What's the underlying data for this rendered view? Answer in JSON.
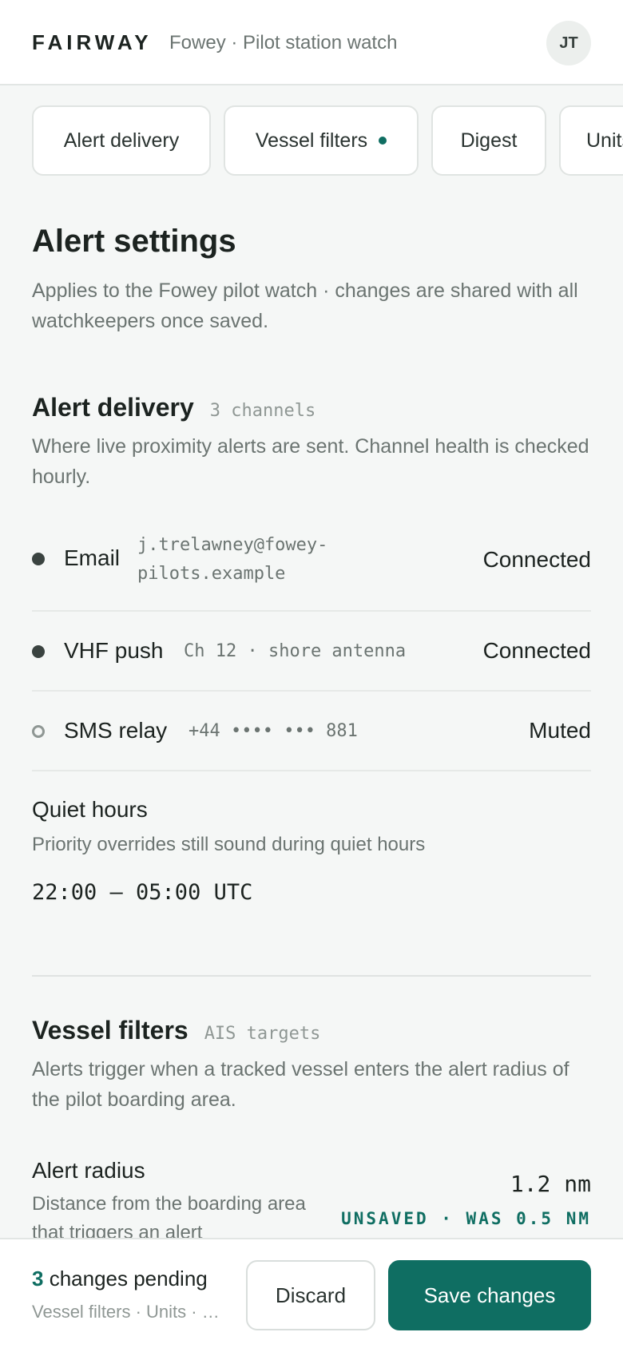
{
  "app": {
    "brand": "FAIRWAY",
    "context": "Fowey · Pilot station watch",
    "user_initials": "JT"
  },
  "tabs": [
    {
      "label": "Alert delivery",
      "has_changes": false
    },
    {
      "label": "Vessel filters",
      "has_changes": true
    },
    {
      "label": "Digest",
      "has_changes": false
    },
    {
      "label": "Units",
      "has_changes": false
    }
  ],
  "page": {
    "title": "Alert settings",
    "subtitle": "Applies to the Fowey pilot watch · changes are shared with all watchkeepers once saved."
  },
  "alert_delivery": {
    "title": "Alert delivery",
    "tag": "3 channels",
    "description": "Where live proximity alerts are sent. Channel health is checked hourly.",
    "channels": [
      {
        "name": "Email",
        "detail": "j.trelawney@fowey-pilots.example",
        "status": "Connected",
        "active": true
      },
      {
        "name": "VHF push",
        "detail": "Ch 12 · shore antenna",
        "status": "Connected",
        "active": true
      },
      {
        "name": "SMS relay",
        "detail": "+44 •••• ••• 881",
        "status": "Muted",
        "active": false
      }
    ],
    "quiet_hours": {
      "title": "Quiet hours",
      "description": "Priority overrides still sound during quiet hours",
      "value": "22:00 – 05:00 UTC"
    }
  },
  "vessel_filters": {
    "title": "Vessel filters",
    "tag": "AIS targets",
    "description": "Alerts trigger when a tracked vessel enters the alert radius of the pilot boarding area.",
    "alert_radius": {
      "label": "Alert radius",
      "description": "Distance from the boarding area that triggers an alert",
      "value": "1.2 nm",
      "unsaved_note": "UNSAVED · WAS 0.5 NM"
    }
  },
  "save_bar": {
    "pending_count": "3",
    "pending_label": " changes pending",
    "pending_sections": "Vessel filters · Units · Digest",
    "discard_label": "Discard",
    "save_label": "Save changes"
  },
  "colors": {
    "accent": "#0f6e62",
    "background": "#f5f7f6",
    "text": "#1c2320",
    "muted_text": "#6b7471"
  }
}
